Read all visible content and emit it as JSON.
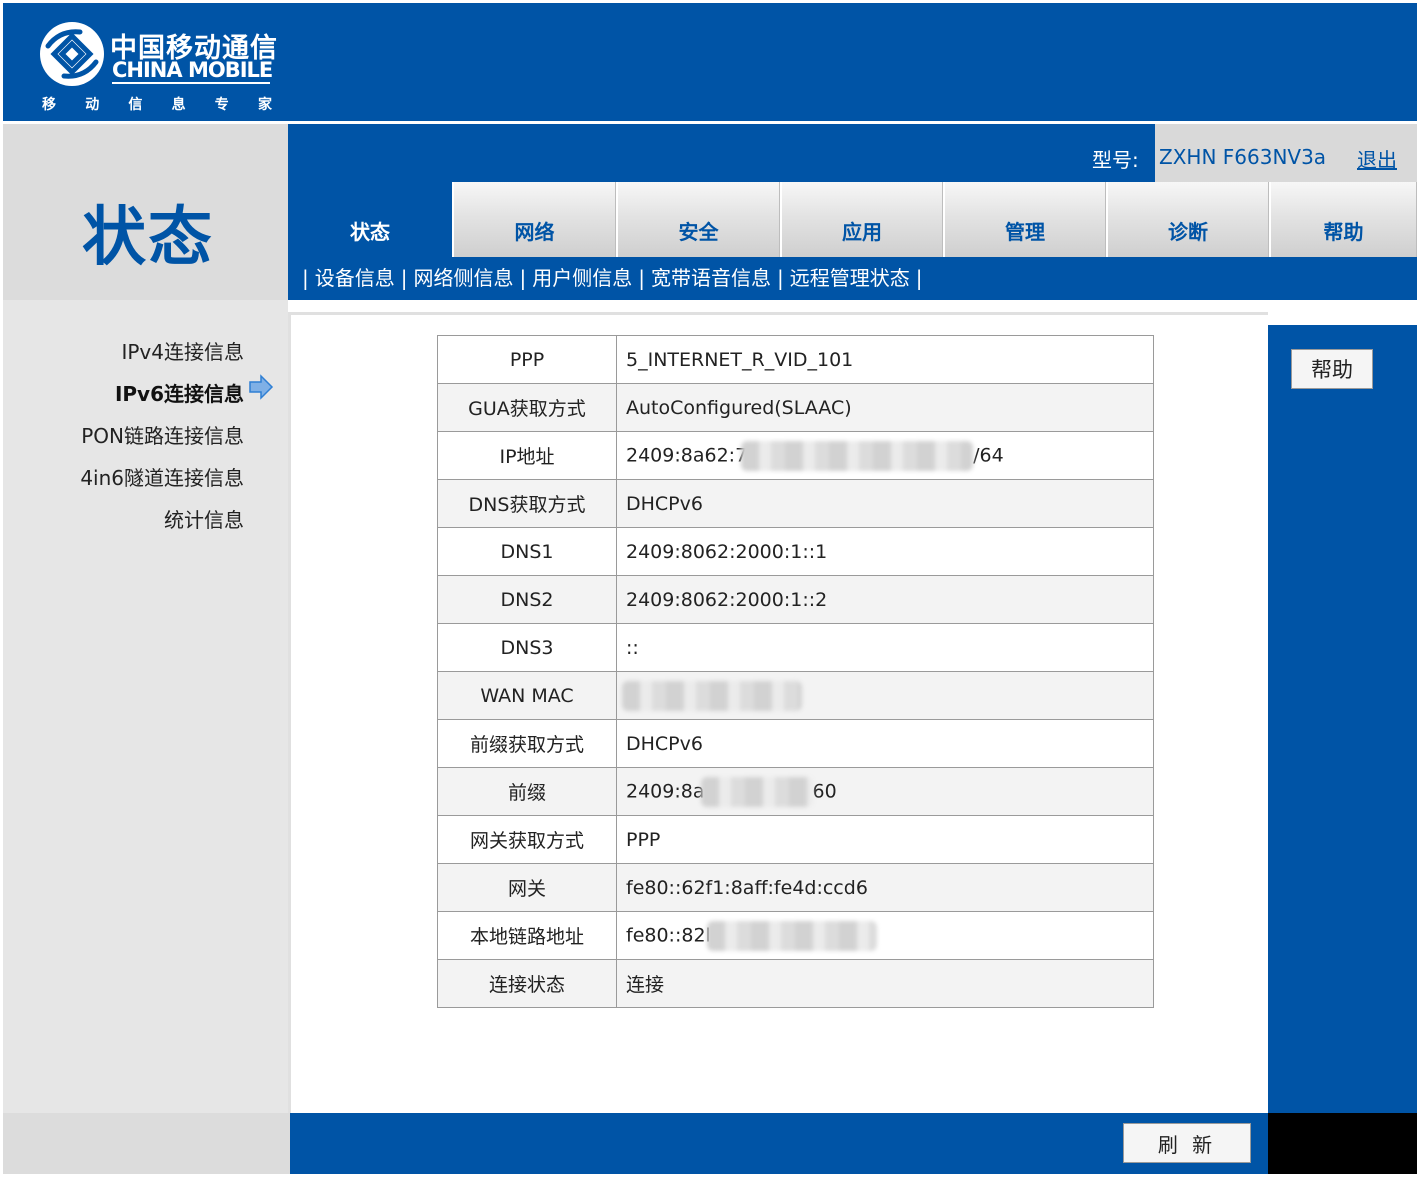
{
  "brand": {
    "name_cn": "中国移动通信",
    "name_en": "CHINA MOBILE",
    "slogan_chars": [
      "移",
      "动",
      "信",
      "息",
      "专",
      "家"
    ]
  },
  "page_title": "状态",
  "header": {
    "model_label": "型号:",
    "model_value": "ZXHN F663NV3a",
    "logout": "退出"
  },
  "tabs": [
    {
      "label": "状态",
      "active": true
    },
    {
      "label": "网络",
      "active": false
    },
    {
      "label": "安全",
      "active": false
    },
    {
      "label": "应用",
      "active": false
    },
    {
      "label": "管理",
      "active": false
    },
    {
      "label": "诊断",
      "active": false
    },
    {
      "label": "帮助",
      "active": false
    }
  ],
  "subnav": {
    "separator": "|",
    "items": [
      {
        "label": "设备信息",
        "current": false
      },
      {
        "label": "网络侧信息",
        "current": true
      },
      {
        "label": "用户侧信息",
        "current": false
      },
      {
        "label": "宽带语音信息",
        "current": false
      },
      {
        "label": "远程管理状态",
        "current": false
      }
    ]
  },
  "sidebar": {
    "items": [
      {
        "label": "IPv4连接信息",
        "current": false
      },
      {
        "label": "IPv6连接信息",
        "current": true
      },
      {
        "label": "PON链路连接信息",
        "current": false
      },
      {
        "label": "4in6隧道连接信息",
        "current": false
      },
      {
        "label": "统计信息",
        "current": false
      }
    ]
  },
  "info_table": {
    "rows": [
      {
        "key": "PPP",
        "value": "5_INTERNET_R_VID_101"
      },
      {
        "key": "GUA获取方式",
        "value": "AutoConfigured(SLAAC)"
      },
      {
        "key": "IP地址",
        "value_prefix": "2409:8a62:7",
        "value_suffix": "/64",
        "redacted": true
      },
      {
        "key": "DNS获取方式",
        "value": "DHCPv6"
      },
      {
        "key": "DNS1",
        "value": "2409:8062:2000:1::1"
      },
      {
        "key": "DNS2",
        "value": "2409:8062:2000:1::2"
      },
      {
        "key": "DNS3",
        "value": "::"
      },
      {
        "key": "WAN MAC",
        "value_prefix": "",
        "value_suffix": "",
        "redacted": true
      },
      {
        "key": "前缀获取方式",
        "value": "DHCPv6"
      },
      {
        "key": "前缀",
        "value_prefix": "2409:8a",
        "value_suffix": "60",
        "redacted": true
      },
      {
        "key": "网关获取方式",
        "value": "PPP"
      },
      {
        "key": "网关",
        "value": "fe80::62f1:8aff:fe4d:ccd6"
      },
      {
        "key": "本地链路地址",
        "value_prefix": "fe80::82l",
        "value_suffix": "",
        "redacted": true
      },
      {
        "key": "连接状态",
        "value": "连接"
      }
    ]
  },
  "buttons": {
    "help": "帮助",
    "refresh": "刷 新"
  },
  "colors": {
    "brand_blue": "#0054a6",
    "panel_gray": "#dcdcdc"
  },
  "icons": {
    "logo": "china-mobile-logo-icon",
    "current_arrow": "arrow-right-icon"
  }
}
